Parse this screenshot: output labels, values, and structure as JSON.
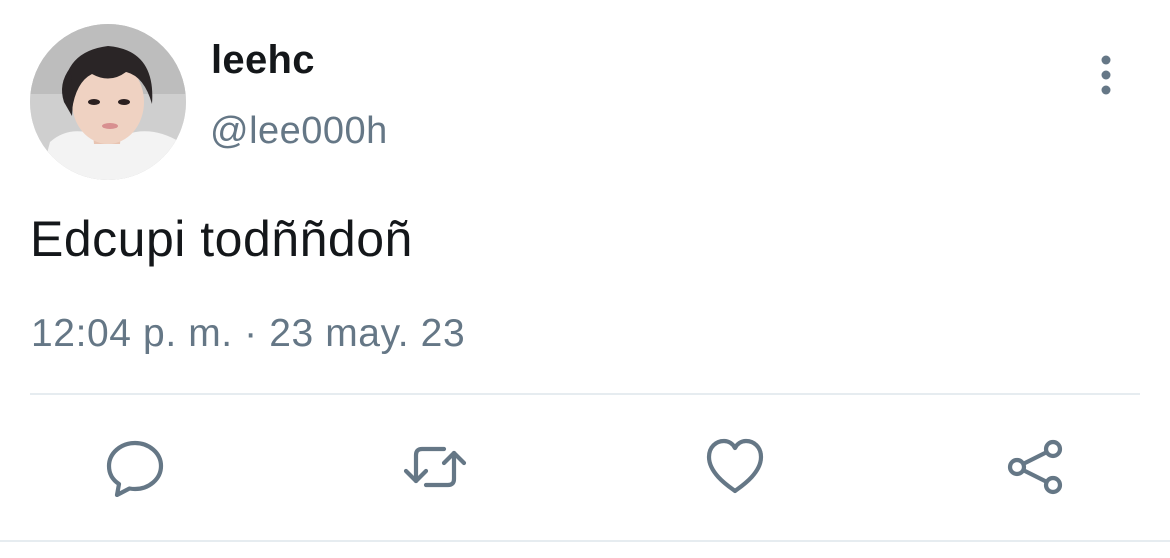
{
  "user": {
    "display_name": "leehc",
    "handle": "@lee000h",
    "avatar_icon": "profile-photo"
  },
  "tweet": {
    "text": "Edcupi todññdoñ",
    "time": "12:04 p. m.",
    "separator": "·",
    "date": "23 may. 23"
  },
  "actions": {
    "reply_icon": "reply-icon",
    "retweet_icon": "retweet-icon",
    "like_icon": "heart-icon",
    "share_icon": "share-icon",
    "more_icon": "more-vertical-icon"
  },
  "colors": {
    "icon": "#657786",
    "text": "#14171a",
    "secondary_text": "#657786",
    "divider": "#e6ecf0"
  }
}
